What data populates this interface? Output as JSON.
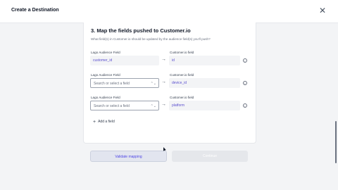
{
  "header": {
    "title": "Create a Destination",
    "close_glyph": "✕"
  },
  "step": {
    "title": "3. Map the fields pushed to Customer.io",
    "description": "What field(s) in Customer.io should be updated by the audience field(s) you'll push?"
  },
  "mappings": [
    {
      "left_label": "Lago Audience Field",
      "left_value": "customer_id",
      "left_placeholder": "",
      "right_label": "Customer.io field",
      "right_value": "id"
    },
    {
      "left_label": "Lago Audience Field",
      "left_value": "",
      "left_placeholder": "Search or select a field",
      "right_label": "Customer.io field",
      "right_value": "device_id"
    },
    {
      "left_label": "Lago Audience Field",
      "left_value": "",
      "left_placeholder": "Search or select a field",
      "right_label": "Customer.io field",
      "right_value": "platform"
    }
  ],
  "arrow_glyph": "→",
  "chevron_glyph": "⌃⌄",
  "info_glyph": "i",
  "add_field": {
    "plus": "+",
    "label": "Add a field"
  },
  "buttons": {
    "validate": "Validate mapping",
    "continue": "Continue"
  },
  "colors": {
    "accent": "#5b4fcf",
    "validate_bg": "#e2e5ef"
  }
}
